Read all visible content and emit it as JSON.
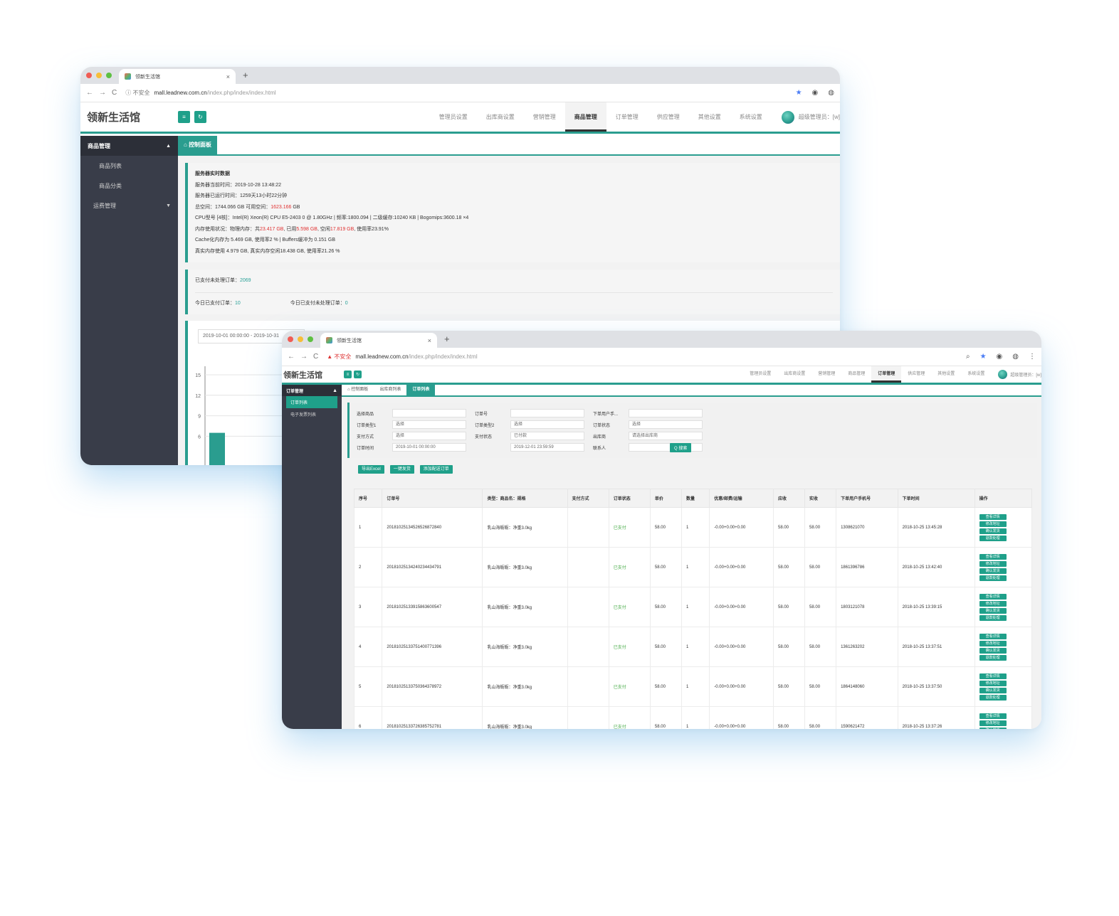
{
  "window1": {
    "tab_title": "领新生活馆",
    "new_tab_symbol": "+",
    "tab_close_symbol": "×",
    "nav_symbols": "←→C",
    "security": "ⓘ 不安全",
    "url_host": "mall.leadnew.com.cn",
    "url_path": "/index.php/index/index.html",
    "brand": "领新生活馆",
    "menu": [
      "管理员设置",
      "出库商设置",
      "营销管理",
      "商品管理",
      "订单管理",
      "供应管理",
      "其他设置",
      "系统设置"
    ],
    "menu_active": "商品管理",
    "user": "超级管理员：[w]",
    "sidebar": {
      "head": "商品管理",
      "items": [
        "商品列表",
        "商品分类"
      ],
      "group": "运费管理"
    },
    "page_tab": "控制面板",
    "server": {
      "title": "服务器实时数据",
      "time": "服务器当前时间：2019-10-28 13:48:22",
      "uptime": "服务器已运行时间：1259天13小时22分钟",
      "space_prefix": "总空间：1744.066 GB    可用空间：",
      "space_free": "1623.166",
      "space_suffix": " GB",
      "cpu": "CPU型号 [4核]：Intel(R) Xeon(R) CPU E5-2403 0 @ 1.80GHz | 频率:1800.094 | 二级缓存:10240 KB | Bogomips:3600.18 ×4",
      "mem_prefix": "内存使用状况：物理内存：共",
      "mem_total": "23.417 GB",
      "mem_mid1": ", 已用",
      "mem_used": "5.598 GB",
      "mem_mid2": ", 空闲",
      "mem_free": "17.819 GB",
      "mem_suffix": ", 使用率23.91%",
      "cache": "Cache化内存为 5.469 GB, 使用率2 % | Buffers缓冲为 0.151 GB",
      "real": "真实内存使用 4.979 GB, 真实内存空闲18.438 GB, 使用率21.26 %"
    },
    "orders": {
      "unshipped_label": "已支付未处理订单：",
      "unshipped_value": "2069",
      "today_paid_label": "今日已支付订单：",
      "today_paid_value": "10",
      "today_unshipped_label": "今日已支付未处理订单：",
      "today_unshipped_value": "0"
    },
    "date_range": "2019-10-01 00:00:00 - 2019-10-31",
    "chart_data": {
      "type": "bar",
      "y_ticks": [
        "15",
        "12",
        "9",
        "6"
      ],
      "ylim": [
        0,
        15
      ],
      "values": [
        6.5
      ],
      "color": "#2a9d8f"
    }
  },
  "window2": {
    "tab_title": "领新生活馆",
    "new_tab_symbol": "+",
    "tab_close_symbol": "×",
    "nav_symbols": "←→C",
    "security": "▲ 不安全",
    "url_host": "mall.leadnew.com.cn",
    "url_path": "/index.php/index/index.html",
    "brand": "领新生活馆",
    "menu": [
      "管理员设置",
      "出库商设置",
      "营销管理",
      "商品管理",
      "订单管理",
      "供应管理",
      "其他设置",
      "系统设置"
    ],
    "menu_active": "订单管理",
    "user": "超级管理员：[w]",
    "sidebar": {
      "head": "订单管理",
      "active_item": "订单列表",
      "item": "电子发票列表"
    },
    "page_tabs": [
      "控制面板",
      "出库商列表",
      "订单列表"
    ],
    "filters": {
      "row1": [
        {
          "label": "选择商品",
          "value": ""
        },
        {
          "label": "订单号",
          "value": ""
        },
        {
          "label": "下单用户手...",
          "value": ""
        }
      ],
      "row2": [
        {
          "label": "订单类型1",
          "value": "选择"
        },
        {
          "label": "订单类型2",
          "value": "选择"
        },
        {
          "label": "订单状态",
          "value": "选择"
        }
      ],
      "row3": [
        {
          "label": "支付方式",
          "value": "选择"
        },
        {
          "label": "支付状态",
          "value": "已付款"
        },
        {
          "label": "出库商",
          "value": "请选择出库商"
        }
      ],
      "row4": [
        {
          "label": "订单时间",
          "value": "2019-10-01 00:00:00"
        },
        {
          "label": "",
          "value": "2019-12-01 23:59:59"
        },
        {
          "label": "联系人",
          "value": ""
        }
      ],
      "search": "Q 搜索"
    },
    "actions": [
      "导出Excel",
      "一键发货",
      "添加配送订单"
    ],
    "table": {
      "headers": [
        "序号",
        "订单号",
        "类型：商品名：规格",
        "支付方式",
        "订单状态",
        "单价",
        "数量",
        "优惠/邮费/运输",
        "应收",
        "实收",
        "下单用户手机号",
        "下单时间",
        "操作"
      ],
      "rows": [
        [
          "1",
          "20181025134526526872840",
          "乳山海蛎蛎：净重3.0kg",
          "",
          "已支付",
          "58.00",
          "1",
          "-0.00+0.00+0.00",
          "58.00",
          "58.00",
          "1308621070",
          "2018-10-25 13:45:28"
        ],
        [
          "2",
          "20181025134240234434791",
          "乳山海蛎蛎：净重3.0kg",
          "",
          "已支付",
          "58.00",
          "1",
          "-0.00+0.00+0.00",
          "58.00",
          "58.00",
          "1861396786",
          "2018-10-25 13:42:40"
        ],
        [
          "3",
          "20181025133915863600547",
          "乳山海蛎蛎：净重3.0kg",
          "",
          "已支付",
          "58.00",
          "1",
          "-0.00+0.00+0.00",
          "58.00",
          "58.00",
          "1803121078",
          "2018-10-25 13:39:15"
        ],
        [
          "4",
          "20181025133751400771396",
          "乳山海蛎蛎：净重3.0kg",
          "",
          "已支付",
          "58.00",
          "1",
          "-0.00+0.00+0.00",
          "58.00",
          "58.00",
          "1361263202",
          "2018-10-25 13:37:51"
        ],
        [
          "5",
          "20181025133750364378972",
          "乳山海蛎蛎：净重3.0kg",
          "",
          "已支付",
          "58.00",
          "1",
          "-0.00+0.00+0.00",
          "58.00",
          "58.00",
          "1864148060",
          "2018-10-25 13:37:50"
        ],
        [
          "6",
          "20181025133726385752781",
          "乳山海蛎蛎：净重3.0kg",
          "",
          "已支付",
          "58.00",
          "1",
          "-0.00+0.00+0.00",
          "58.00",
          "58.00",
          "1590621472",
          "2018-10-25 13:37:26"
        ]
      ],
      "op_labels": [
        "查看详情",
        "修改地址",
        "确认发货",
        "退款处理"
      ]
    }
  },
  "colors": {
    "accent": "#2a9d8f",
    "sidebar": "#393d49",
    "highlight": "#e03131",
    "paid": "#4cae4c"
  }
}
